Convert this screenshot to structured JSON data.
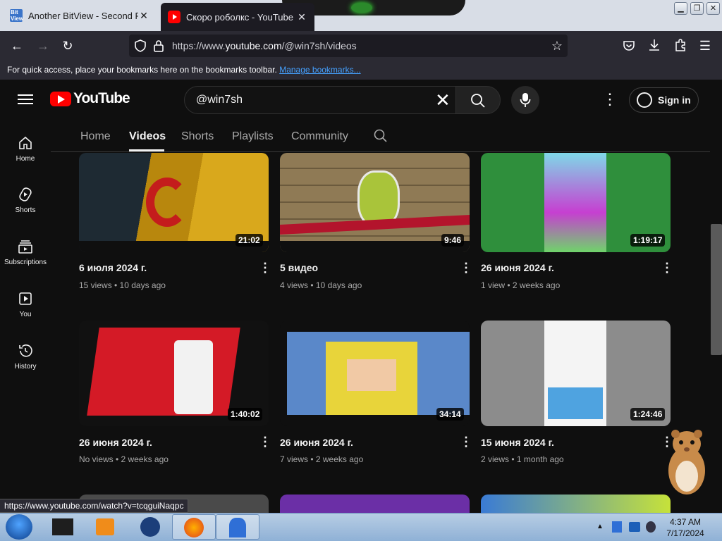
{
  "browser": {
    "tabs": [
      {
        "title": "Another BitView - Second Previ",
        "active": false
      },
      {
        "title": "Скоро роболкс - YouTube",
        "active": true
      }
    ],
    "address": {
      "prefix": "https://www.",
      "host": "youtube.com",
      "path": "/@win7sh/videos"
    },
    "bookmarks_text": "For quick access, place your bookmarks here on the bookmarks toolbar.",
    "bookmarks_link": "Manage bookmarks...",
    "status_url": "https://www.youtube.com/watch?v=tcqguiNaqpc"
  },
  "youtube": {
    "logo_text": "YouTube",
    "search_value": "@win7sh",
    "sign_in": "Sign in",
    "sidebar": [
      {
        "label": "Home",
        "icon": "home-icon"
      },
      {
        "label": "Shorts",
        "icon": "shorts-icon"
      },
      {
        "label": "Subscriptions",
        "icon": "subscriptions-icon"
      },
      {
        "label": "You",
        "icon": "you-icon"
      },
      {
        "label": "History",
        "icon": "history-icon"
      }
    ],
    "channel_tabs": [
      "Home",
      "Videos",
      "Shorts",
      "Playlists",
      "Community"
    ],
    "active_tab": "Videos",
    "videos": [
      {
        "title": "6 июля 2024 г.",
        "meta": "15 views • 10 days ago",
        "duration": "21:02"
      },
      {
        "title": "5 видео",
        "meta": "4 views • 10 days ago",
        "duration": "9:46"
      },
      {
        "title": "26 июня 2024 г.",
        "meta": "1 view • 2 weeks ago",
        "duration": "1:19:17"
      },
      {
        "title": "26 июня 2024 г.",
        "meta": "No views • 2 weeks ago",
        "duration": "1:40:02"
      },
      {
        "title": "26 июня 2024 г.",
        "meta": "7 views • 2 weeks ago",
        "duration": "34:14"
      },
      {
        "title": "15 июня 2024 г.",
        "meta": "2 views • 1 month ago",
        "duration": "1:24:46"
      }
    ]
  },
  "taskbar": {
    "time": "4:37 AM",
    "date": "7/17/2024"
  },
  "colors": {
    "yt_red": "#ff0000",
    "background": "#0f0f0f",
    "link": "#45a1ff"
  }
}
